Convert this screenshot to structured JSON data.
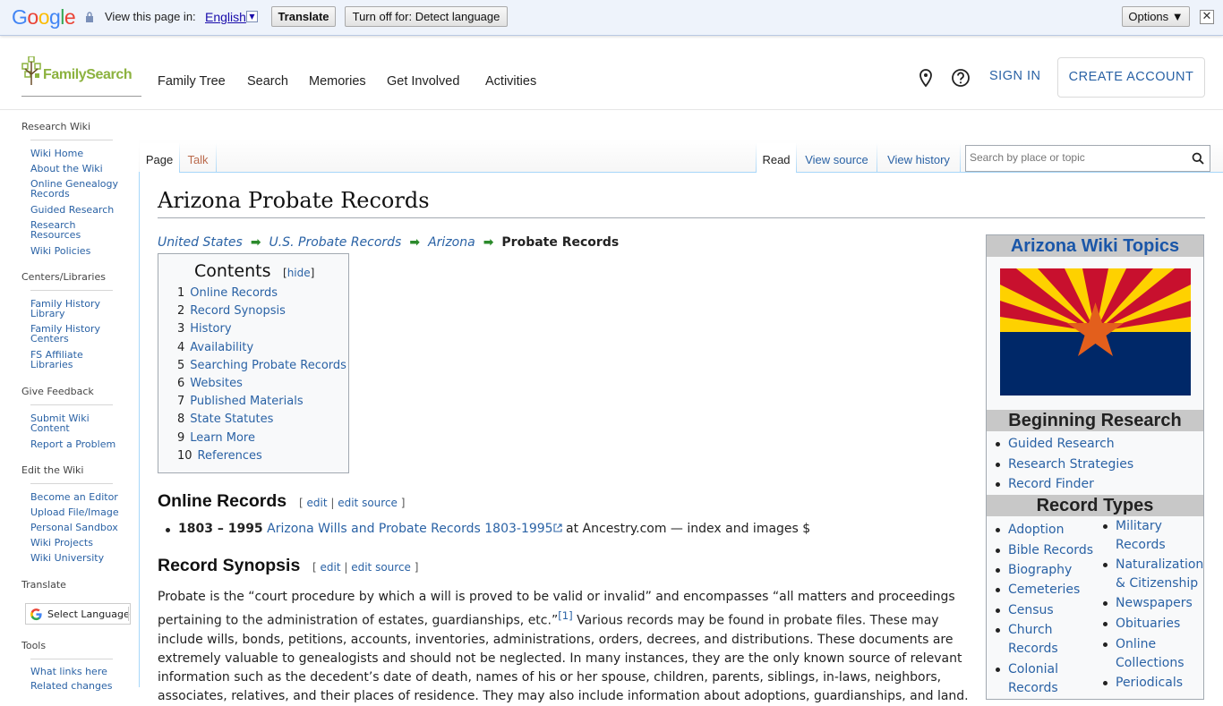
{
  "translate_bar": {
    "prompt": "View this page in:",
    "language": "English",
    "translate_label": "Translate",
    "turn_off_label": "Turn off for: Detect language",
    "options_label": "Options ▼",
    "close_glyph": "✕"
  },
  "header": {
    "logo_text": "FamilySearch",
    "nav": [
      "Family Tree",
      "Search",
      "Memories",
      "Get Involved",
      "Activities"
    ],
    "signin": "SIGN IN",
    "create_account": "CREATE ACCOUNT"
  },
  "sidebar": {
    "research_wiki": "Research Wiki",
    "wiki_links": [
      "Wiki Home",
      "About the Wiki",
      "Online Genealogy Records",
      "Guided Research",
      "Research Resources",
      "Wiki Policies"
    ],
    "centers_heading": "Centers/Libraries",
    "centers_links": [
      "Family History Library",
      "Family History Centers",
      "FS Affiliate Libraries"
    ],
    "feedback_heading": "Give Feedback",
    "feedback_links": [
      "Submit Wiki Content",
      "Report a Problem"
    ],
    "edit_heading": "Edit the Wiki",
    "edit_links": [
      "Become an Editor",
      "Upload File/Image",
      "Personal Sandbox",
      "Wiki Projects",
      "Wiki University"
    ],
    "translate_heading": "Translate",
    "select_language": "Select Language",
    "tools_heading": "Tools",
    "tools_links": [
      "What links here",
      "Related changes"
    ]
  },
  "tabs": {
    "page": "Page",
    "talk": "Talk",
    "read": "Read",
    "view_source": "View source",
    "view_history": "View history",
    "search_placeholder": "Search by place or topic"
  },
  "article": {
    "title": "Arizona Probate Records",
    "breadcrumbs": [
      "United States",
      "U.S. Probate Records",
      "Arizona"
    ],
    "breadcrumb_current": "Probate Records",
    "toc_title": "Contents",
    "toc_hide": "hide",
    "toc": [
      {
        "num": "1",
        "label": "Online Records"
      },
      {
        "num": "2",
        "label": "Record Synopsis"
      },
      {
        "num": "3",
        "label": "History"
      },
      {
        "num": "4",
        "label": "Availability"
      },
      {
        "num": "5",
        "label": "Searching Probate Records"
      },
      {
        "num": "6",
        "label": "Websites"
      },
      {
        "num": "7",
        "label": "Published Materials"
      },
      {
        "num": "8",
        "label": "State Statutes"
      },
      {
        "num": "9",
        "label": "Learn More"
      },
      {
        "num": "10",
        "label": "References"
      }
    ],
    "sec1_title": "Online Records",
    "sec2_title": "Record Synopsis",
    "edit": "edit",
    "edit_source": "edit source",
    "record_years": "1803 – 1995",
    "record_link": "Arizona Wills and Probate Records 1803-1995",
    "record_tail": " at Ancestry.com — index and images $",
    "para_before_ref": "Probate is the “court procedure by which a will is proved to be valid or invalid” and encompasses “all matters and proceedings pertaining to the administration of estates, guardianships, etc.”",
    "ref_mark": "[1]",
    "para_after_ref": " Various records may be found in probate files. These may include wills, bonds, petitions, accounts, inventories, administrations, orders, decrees, and distributions. These documents are extremely valuable to genealogists and should not be neglected. In many instances, they are the only known source of relevant information such as the decedent’s date of death, names of his or her spouse, children, parents, siblings, in-laws, neighbors, associates, relatives, and their places of residence. They may also include information about adoptions, guardianships, and land."
  },
  "infobox": {
    "title": "Arizona Wiki Topics",
    "beginning_heading": "Beginning Research",
    "beginning": [
      "Guided Research",
      "Research Strategies",
      "Record Finder"
    ],
    "types_heading": "Record Types",
    "types_left": [
      "Adoption",
      "Bible Records",
      "Biography",
      "Cemeteries",
      "Census",
      "Church Records",
      "Colonial Records"
    ],
    "types_right": [
      "Military Records",
      "Naturalization & Citizenship",
      "Newspapers",
      "Obituaries",
      "Online Collections",
      "Periodicals"
    ]
  },
  "colors": {
    "link": "#2a62a5",
    "brand_green": "#8cb23f",
    "flag_red": "#c8102e",
    "flag_yellow": "#fed100",
    "flag_blue": "#002868",
    "flag_star": "#e35f1c"
  }
}
